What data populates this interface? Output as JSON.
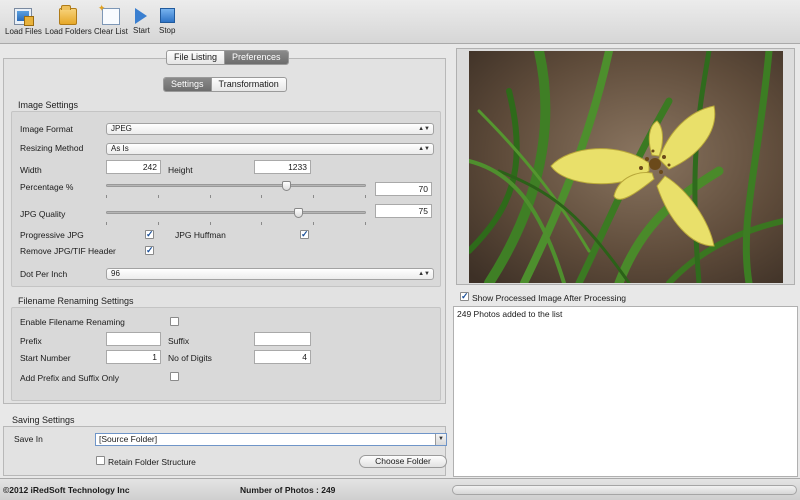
{
  "toolbar": {
    "load_files": "Load Files",
    "load_folders": "Load Folders",
    "clear_list": "Clear List",
    "start": "Start",
    "stop": "Stop"
  },
  "top_tabs": {
    "file_listing": "File Listing",
    "preferences": "Preferences",
    "active": "preferences"
  },
  "sub_tabs": {
    "settings": "Settings",
    "transformation": "Transformation",
    "active": "settings"
  },
  "image_settings": {
    "title": "Image Settings",
    "image_format_label": "Image Format",
    "image_format_value": "JPEG",
    "resizing_method_label": "Resizing Method",
    "resizing_method_value": "As Is",
    "width_label": "Width",
    "width_value": "242",
    "height_label": "Height",
    "height_value": "1233",
    "percentage_label": "Percentage %",
    "percentage_value": "70",
    "percentage_fraction": 0.7,
    "jpg_quality_label": "JPG Quality",
    "jpg_quality_value": "75",
    "jpg_quality_fraction": 0.75,
    "progressive_jpg_label": "Progressive JPG",
    "progressive_jpg_checked": true,
    "jpg_huffman_label": "JPG Huffman",
    "jpg_huffman_checked": true,
    "remove_header_label": "Remove JPG/TIF Header",
    "remove_header_checked": true,
    "dpi_label": "Dot Per Inch",
    "dpi_value": "96"
  },
  "renaming": {
    "title": "Filename Renaming Settings",
    "enable_label": "Enable Filename Renaming",
    "enable_checked": false,
    "prefix_label": "Prefix",
    "prefix_value": "",
    "suffix_label": "Suffix",
    "suffix_value": "",
    "start_number_label": "Start Number",
    "start_number_value": "1",
    "digits_label": "No of Digits",
    "digits_value": "4",
    "prefix_suffix_only_label": "Add Prefix and Suffix Only",
    "prefix_suffix_only_checked": false
  },
  "saving": {
    "title": "Saving Settings",
    "save_in_label": "Save In",
    "save_in_value": "[Source Folder]",
    "retain_label": "Retain Folder Structure",
    "retain_checked": false,
    "choose_folder": "Choose Folder"
  },
  "preview": {
    "show_processed_label": "Show Processed Image After Processing",
    "show_processed_checked": true
  },
  "log": {
    "lines": [
      "249 Photos added to the list"
    ]
  },
  "status": {
    "copyright": "©2012 iRedSoft Technology Inc",
    "photo_count": "Number of Photos : 249",
    "progress": 0.0
  },
  "colors": {
    "accent": "#3f86da",
    "check": "#1a4f98"
  }
}
